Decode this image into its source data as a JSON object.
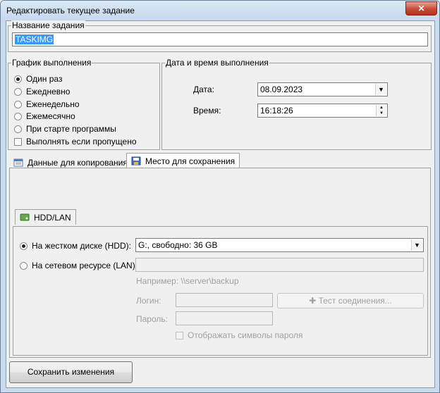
{
  "window": {
    "title": "Редактировать текущее задание",
    "close_glyph": "✕"
  },
  "task_name": {
    "legend": "Название задания",
    "value": "TASKIMG"
  },
  "schedule": {
    "legend": "График выполнения",
    "options": [
      {
        "label": "Один раз",
        "selected": true
      },
      {
        "label": "Ежедневно",
        "selected": false
      },
      {
        "label": "Еженедельно",
        "selected": false
      },
      {
        "label": "Ежемесячно",
        "selected": false
      },
      {
        "label": "При старте программы",
        "selected": false
      }
    ],
    "run_if_missed": {
      "label": "Выполнять если пропущено",
      "checked": false
    }
  },
  "datetime": {
    "legend": "Дата и время выполнения",
    "date_label": "Дата:",
    "date_value": "08.09.2023",
    "time_label": "Время:",
    "time_value": "16:18:26"
  },
  "tabs": [
    {
      "label": "Данные для копирования",
      "icon": "copy-data-icon",
      "active": false
    },
    {
      "label": "Место для сохранения",
      "icon": "save-location-icon",
      "active": true
    }
  ],
  "inner_tab": {
    "label": "HDD/LAN",
    "icon": "hdd-lan-icon"
  },
  "destination": {
    "hdd": {
      "label": "На жестком диске (HDD):",
      "selected": true,
      "value": "G:, свободно: 36 GB"
    },
    "lan": {
      "label": "На сетевом ресурсе (LAN):",
      "selected": false,
      "value": ""
    },
    "example": "Например: \\\\server\\backup",
    "login_label": "Логин:",
    "password_label": "Пароль:",
    "test_button": "Тест соединения...",
    "show_password": "Отображать символы пароля"
  },
  "save_button": "Сохранить изменения",
  "colors": {
    "title_bg": "#c9dcef",
    "close": "#c74a33",
    "selection": "#3399ff"
  }
}
